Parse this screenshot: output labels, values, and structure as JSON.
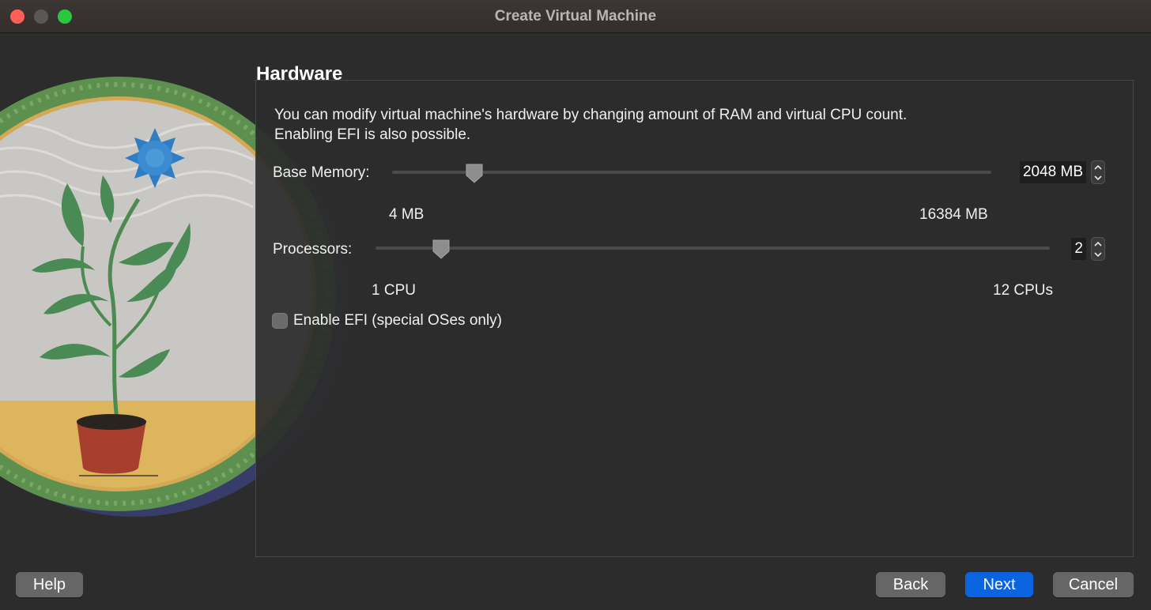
{
  "window": {
    "title": "Create Virtual Machine"
  },
  "section": {
    "title": "Hardware",
    "description_line1": "You can modify virtual machine's hardware by changing amount of RAM and virtual CPU count.",
    "description_line2": "Enabling EFI is also possible."
  },
  "memory": {
    "label": "Base Memory:",
    "value": "2048 MB",
    "min_label": "4 MB",
    "max_label": "16384 MB",
    "slider_fraction": 0.137
  },
  "processors": {
    "label": "Processors:",
    "value": "2",
    "min_label": "1 CPU",
    "max_label": "12 CPUs",
    "slider_fraction": 0.097
  },
  "efi": {
    "label": "Enable EFI (special OSes only)",
    "checked": false
  },
  "buttons": {
    "help": "Help",
    "back": "Back",
    "next": "Next",
    "cancel": "Cancel"
  },
  "colors": {
    "accent": "#0a64e0",
    "close": "#fe5f57",
    "maximize": "#28c840"
  },
  "icons": {
    "close": "close-dot-icon",
    "minimize": "minimize-dot-icon",
    "maximize": "maximize-dot-icon",
    "spin_up": "chevron-up-icon",
    "spin_down": "chevron-down-icon"
  }
}
